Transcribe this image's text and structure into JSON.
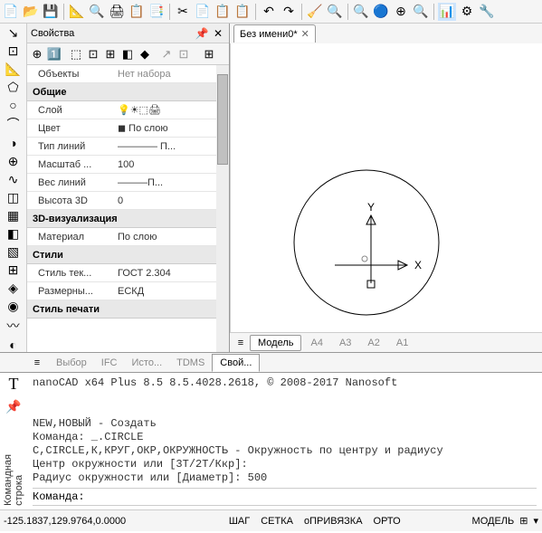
{
  "toolbar": {
    "icons": [
      "📄",
      "📂",
      "💾",
      "📐",
      "🔍",
      "🖨",
      "📋",
      "📑",
      "✂",
      "📄",
      "📋",
      "📋",
      "↶",
      "↷",
      "🧹",
      "🔍",
      "🔍",
      "🔵",
      "⊕",
      "🔍",
      "📊",
      "⚙",
      "🔧"
    ]
  },
  "left_toolbar": [
    "↘",
    "⊡",
    "📐",
    "⬠",
    "○",
    "⌒",
    "◑",
    "⊕",
    "∿",
    "◫",
    "▦",
    "◧",
    "▧",
    "⊞",
    "◈",
    "◉",
    "〰",
    "◐"
  ],
  "props": {
    "title": "Свойства",
    "toolbar_icons": [
      "⊕",
      "1️⃣",
      "⬚",
      "⊡",
      "⊞",
      "◧",
      "◆",
      "↗",
      "⊡",
      "⊞"
    ],
    "objects_label": "Объекты",
    "objects_value": "Нет набора",
    "cat_general": "Общие",
    "rows_general": [
      {
        "label": "Слой",
        "value": ""
      },
      {
        "label": "Цвет",
        "value": "◼ По слою"
      },
      {
        "label": "Тип линий",
        "value": "———— П..."
      },
      {
        "label": "Масштаб ...",
        "value": "100"
      },
      {
        "label": "Вес линий",
        "value": "———П..."
      },
      {
        "label": "Высота 3D",
        "value": "0"
      }
    ],
    "layer_icons": "💡☀⬚🖨",
    "cat_3d": "3D-визуализация",
    "rows_3d": [
      {
        "label": "Материал",
        "value": "По слою"
      }
    ],
    "cat_styles": "Стили",
    "rows_styles": [
      {
        "label": "Стиль тек...",
        "value": "ГОСТ 2.304"
      },
      {
        "label": "Размерны...",
        "value": "ЕСКД"
      }
    ],
    "cat_print": "Стиль печати"
  },
  "bottom_tabs": [
    "Выбор",
    "IFC",
    "Исто...",
    "TDMS",
    "Свой..."
  ],
  "doc_tab": "Без имени0*",
  "layout_tabs": [
    "Модель",
    "A4",
    "A3",
    "A2",
    "A1"
  ],
  "axes": {
    "x": "X",
    "y": "Y"
  },
  "cmd": {
    "vert_label": "Командная строка",
    "log": "nanoCAD x64 Plus 8.5 8.5.4028.2618, © 2008-2017 Nanosoft\n\n\nNEW,НОВЫЙ - Создать\nКоманда: _.CIRCLE\nC,CIRCLE,К,КРУГ,ОКР,ОКРУЖНОСТЬ - Окружность по центру и радиусу\nЦентр окружности или [3T/2T/Ккр]:\nРадиус окружности или [Диаметр]: 500",
    "prompt": "Команда:"
  },
  "status": {
    "coords": "-125.1837,129.9764,0.0000",
    "modes": [
      "ШАГ",
      "СЕТКА",
      "оПРИВЯЗКА",
      "ОРТО"
    ],
    "model": "МОДЕЛЬ"
  }
}
